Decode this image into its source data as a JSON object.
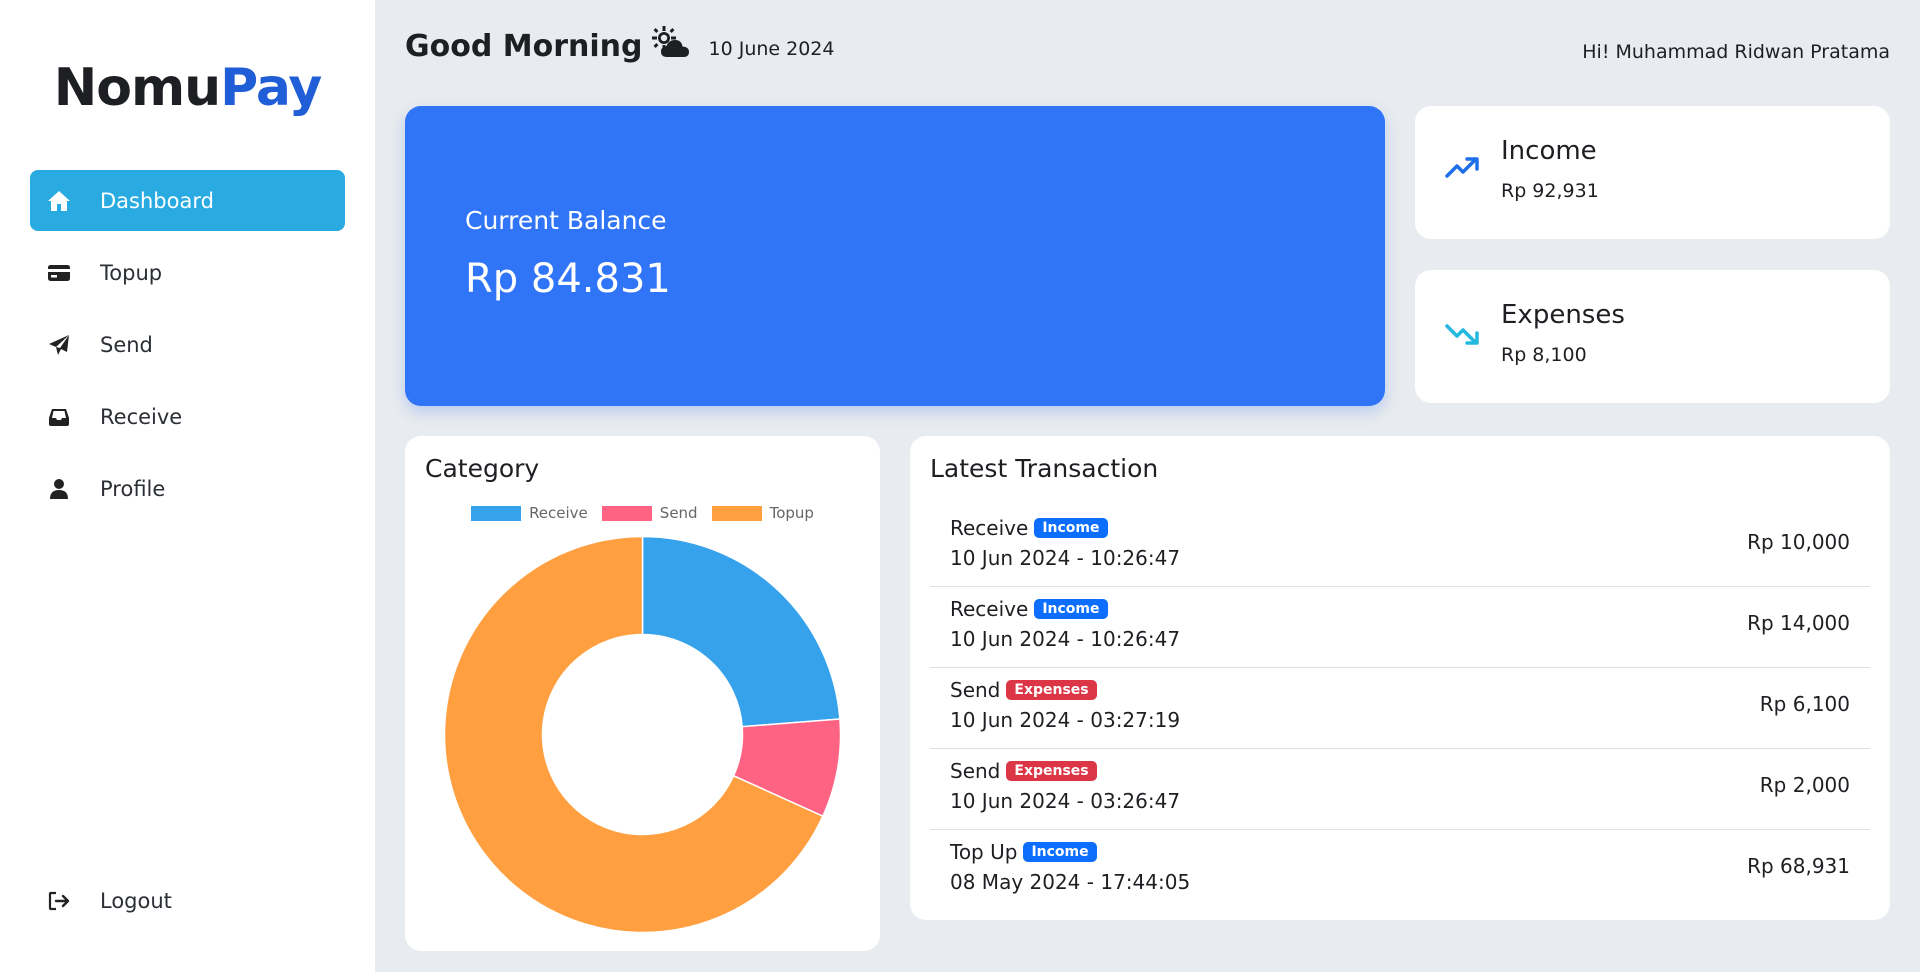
{
  "app": {
    "logo_part1": "Nomu",
    "logo_part2": "Pay"
  },
  "sidebar": {
    "items": [
      {
        "label": "Dashboard",
        "icon": "home-icon",
        "active": true
      },
      {
        "label": "Topup",
        "icon": "credit-card-icon"
      },
      {
        "label": "Send",
        "icon": "paper-plane-icon"
      },
      {
        "label": "Receive",
        "icon": "inbox-icon"
      },
      {
        "label": "Profile",
        "icon": "user-icon"
      }
    ],
    "logout": {
      "label": "Logout",
      "icon": "logout-icon"
    }
  },
  "header": {
    "greeting": "Good Morning",
    "weather_icon": "sun-cloud-icon",
    "date": "10 June 2024",
    "user_greeting": "Hi! Muhammad Ridwan Pratama"
  },
  "balance": {
    "title": "Current Balance",
    "value": "Rp 84.831"
  },
  "income": {
    "title": "Income",
    "value": "Rp 92,931",
    "icon": "trend-up-icon",
    "color": "#1f6feb"
  },
  "expenses": {
    "title": "Expenses",
    "value": "Rp 8,100",
    "icon": "trend-down-icon",
    "color": "#22b8e0"
  },
  "category": {
    "title": "Category"
  },
  "chart_data": {
    "type": "pie",
    "categories": [
      "Receive",
      "Send",
      "Topup"
    ],
    "values": [
      24000,
      8100,
      68931
    ],
    "colors": [
      "#36a2eb",
      "#ff6384",
      "#ff9f40"
    ],
    "legend_position": "top",
    "donut": true
  },
  "transactions": {
    "title": "Latest Transaction",
    "rows": [
      {
        "name": "Receive",
        "badge": "Income",
        "badge_type": "income",
        "date": "10 Jun 2024 - 10:26:47",
        "amount": "Rp 10,000"
      },
      {
        "name": "Receive",
        "badge": "Income",
        "badge_type": "income",
        "date": "10 Jun 2024 - 10:26:47",
        "amount": "Rp 14,000"
      },
      {
        "name": "Send",
        "badge": "Expenses",
        "badge_type": "expenses",
        "date": "10 Jun 2024 - 03:27:19",
        "amount": "Rp 6,100"
      },
      {
        "name": "Send",
        "badge": "Expenses",
        "badge_type": "expenses",
        "date": "10 Jun 2024 - 03:26:47",
        "amount": "Rp 2,000"
      },
      {
        "name": "Top Up",
        "badge": "Income",
        "badge_type": "income",
        "date": "08 May 2024 - 17:44:05",
        "amount": "Rp 68,931"
      }
    ]
  }
}
